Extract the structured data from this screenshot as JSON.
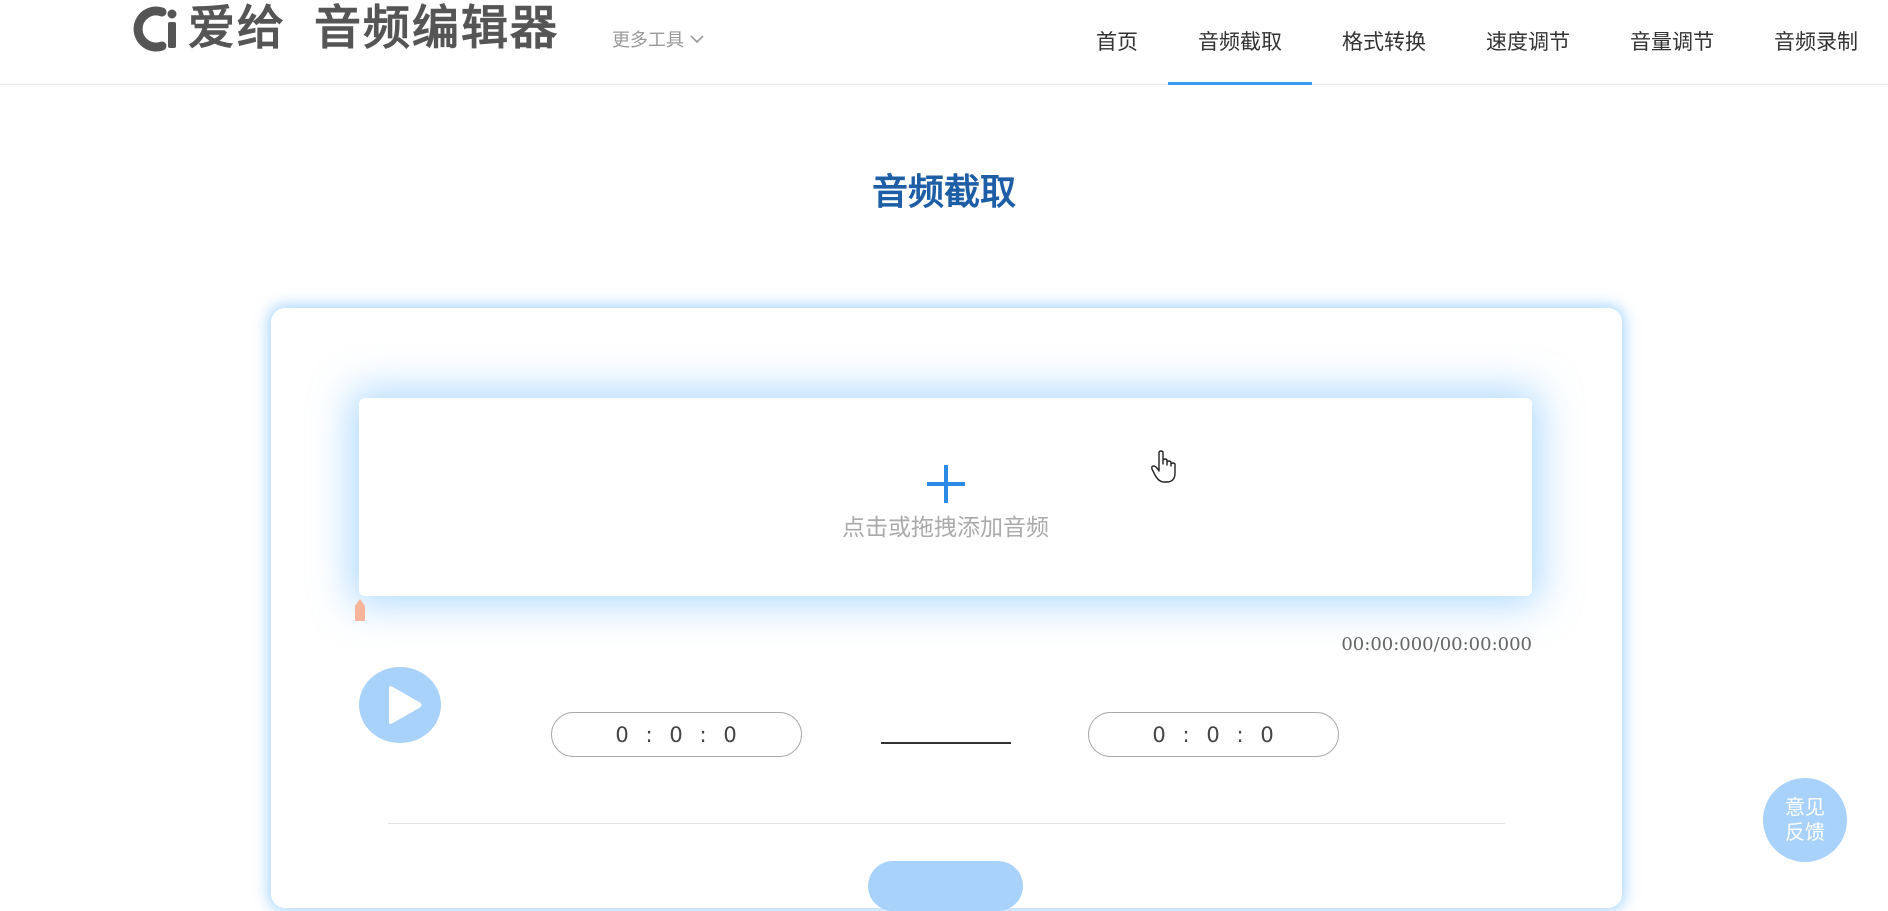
{
  "header": {
    "logo_brand": "爱给",
    "logo_product": "音频编辑器",
    "more_tools": "更多工具",
    "nav": [
      {
        "label": "首页",
        "active": false
      },
      {
        "label": "音频截取",
        "active": true
      },
      {
        "label": "格式转换",
        "active": false
      },
      {
        "label": "速度调节",
        "active": false
      },
      {
        "label": "音量调节",
        "active": false
      },
      {
        "label": "音频录制",
        "active": false
      }
    ]
  },
  "main": {
    "title": "音频截取",
    "upload_text": "点击或拖拽添加音频",
    "time_total": "00:00:000/00:00:000",
    "start_time": {
      "h": "0",
      "m": "0",
      "s": "0"
    },
    "end_time": {
      "h": "0",
      "m": "0",
      "s": "0"
    }
  },
  "feedback": {
    "line1": "意见",
    "line2": "反馈"
  },
  "colors": {
    "accent": "#3a9bef",
    "title": "#1d5ea7",
    "light_blue": "#a9d2fb"
  }
}
